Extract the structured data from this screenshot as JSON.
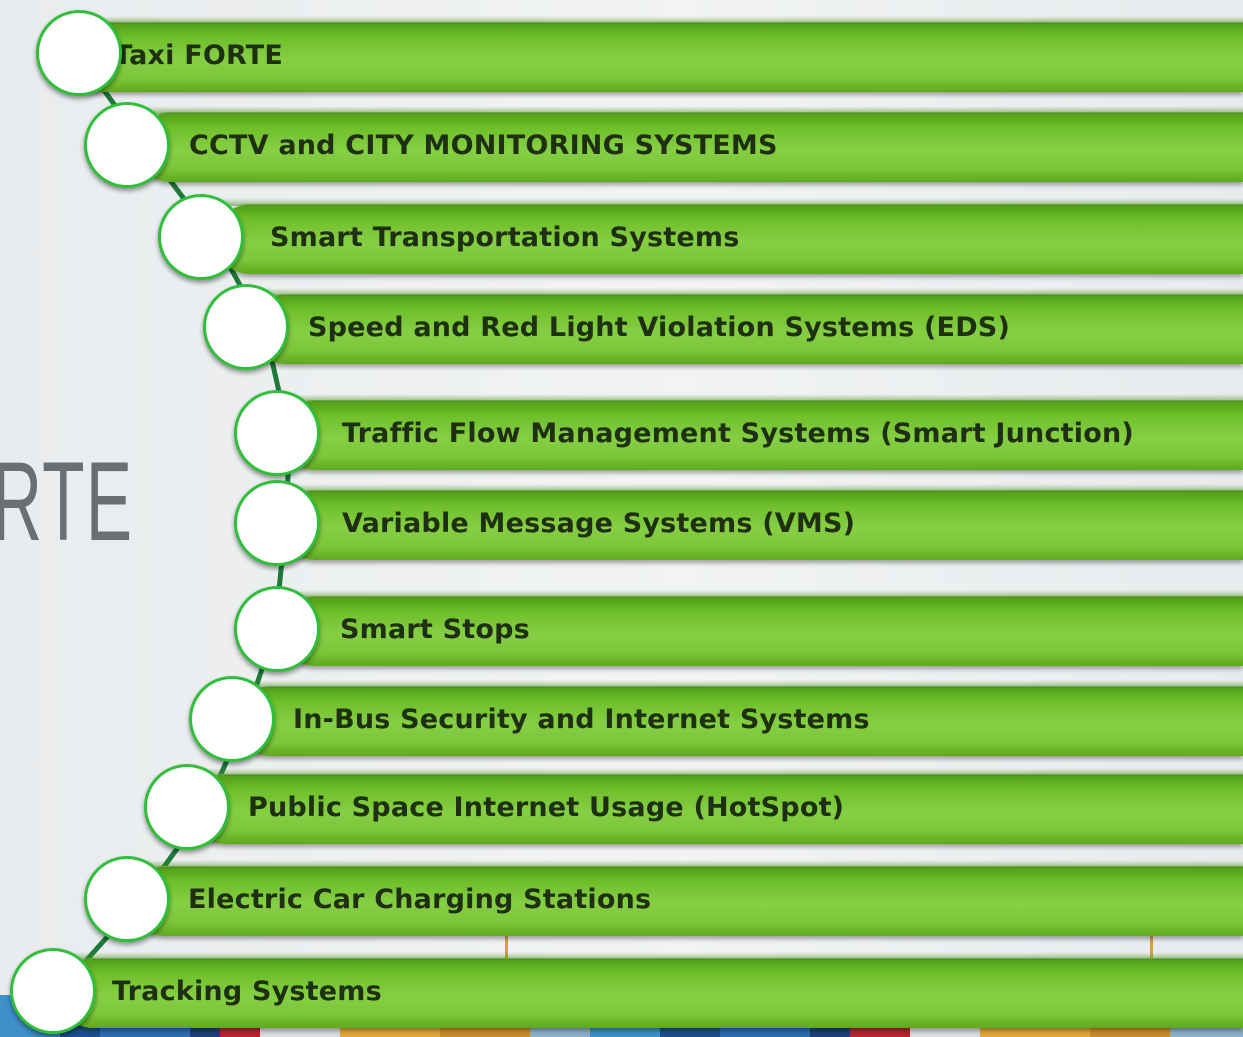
{
  "background_text": "RTE",
  "colors": {
    "bar": "#7cc63b",
    "circle_border": "#2fbf3a",
    "label": "#1f2f12",
    "connector": "#1f7a3a"
  },
  "items": [
    {
      "label": "Taxi FORTE"
    },
    {
      "label": "CCTV and CITY MONITORING SYSTEMS"
    },
    {
      "label": "Smart Transportation Systems"
    },
    {
      "label": "Speed and Red Light Violation Systems (EDS)"
    },
    {
      "label": "Traffic Flow Management Systems (Smart Junction)"
    },
    {
      "label": "Variable Message Systems (VMS)"
    },
    {
      "label": "Smart Stops"
    },
    {
      "label": "In-Bus Security and Internet Systems"
    },
    {
      "label": "Public Space Internet Usage (HotSpot)"
    },
    {
      "label": "Electric Car Charging Stations"
    },
    {
      "label": "Tracking Systems"
    }
  ]
}
